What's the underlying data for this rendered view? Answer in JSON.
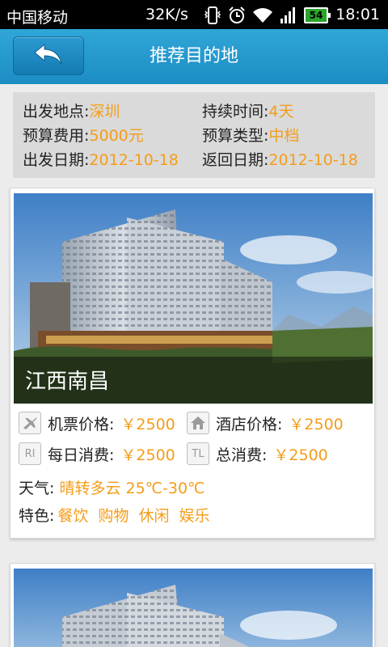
{
  "status_bar": {
    "carrier": "中国移动",
    "speed": "32K/s",
    "battery": "54",
    "time": "18:01",
    "icons": [
      "vibrate-icon",
      "alarm-icon",
      "wifi-icon",
      "signal-icon",
      "battery-icon"
    ]
  },
  "header": {
    "title": "推荐目的地",
    "back_icon": "back-arrow-icon"
  },
  "trip_info": {
    "departure_place": {
      "label": "出发地点:",
      "value": "深圳"
    },
    "duration": {
      "label": "持续时间:",
      "value": "4天"
    },
    "budget_cost": {
      "label": "预算费用:",
      "value": "5000元"
    },
    "budget_type": {
      "label": "预算类型:",
      "value": "中档"
    },
    "departure_date": {
      "label": "出发日期:",
      "value": "2012-10-18"
    },
    "return_date": {
      "label": "返回日期:",
      "value": "2012-10-18"
    }
  },
  "destinations": [
    {
      "city": "江西南昌",
      "flight_price": {
        "icon": "airplane-icon",
        "label": "机票价格:",
        "value": "￥2500"
      },
      "hotel_price": {
        "icon": "house-icon",
        "label": "酒店价格:",
        "value": "￥2500"
      },
      "daily_cost": {
        "icon": "RI",
        "label": "每日消费:",
        "value": "￥2500"
      },
      "total_cost": {
        "icon": "TL",
        "label": "总消费:",
        "value": "￥2500"
      },
      "weather": {
        "label": "天气:",
        "value": "晴转多云 25℃-30℃"
      },
      "features": {
        "label": "特色:",
        "tags": [
          "餐饮",
          "购物",
          "休闲",
          "娱乐"
        ]
      }
    }
  ],
  "colors": {
    "header": "#1b8dc4",
    "accent_value": "#f49d1a",
    "background": "#ececec"
  }
}
